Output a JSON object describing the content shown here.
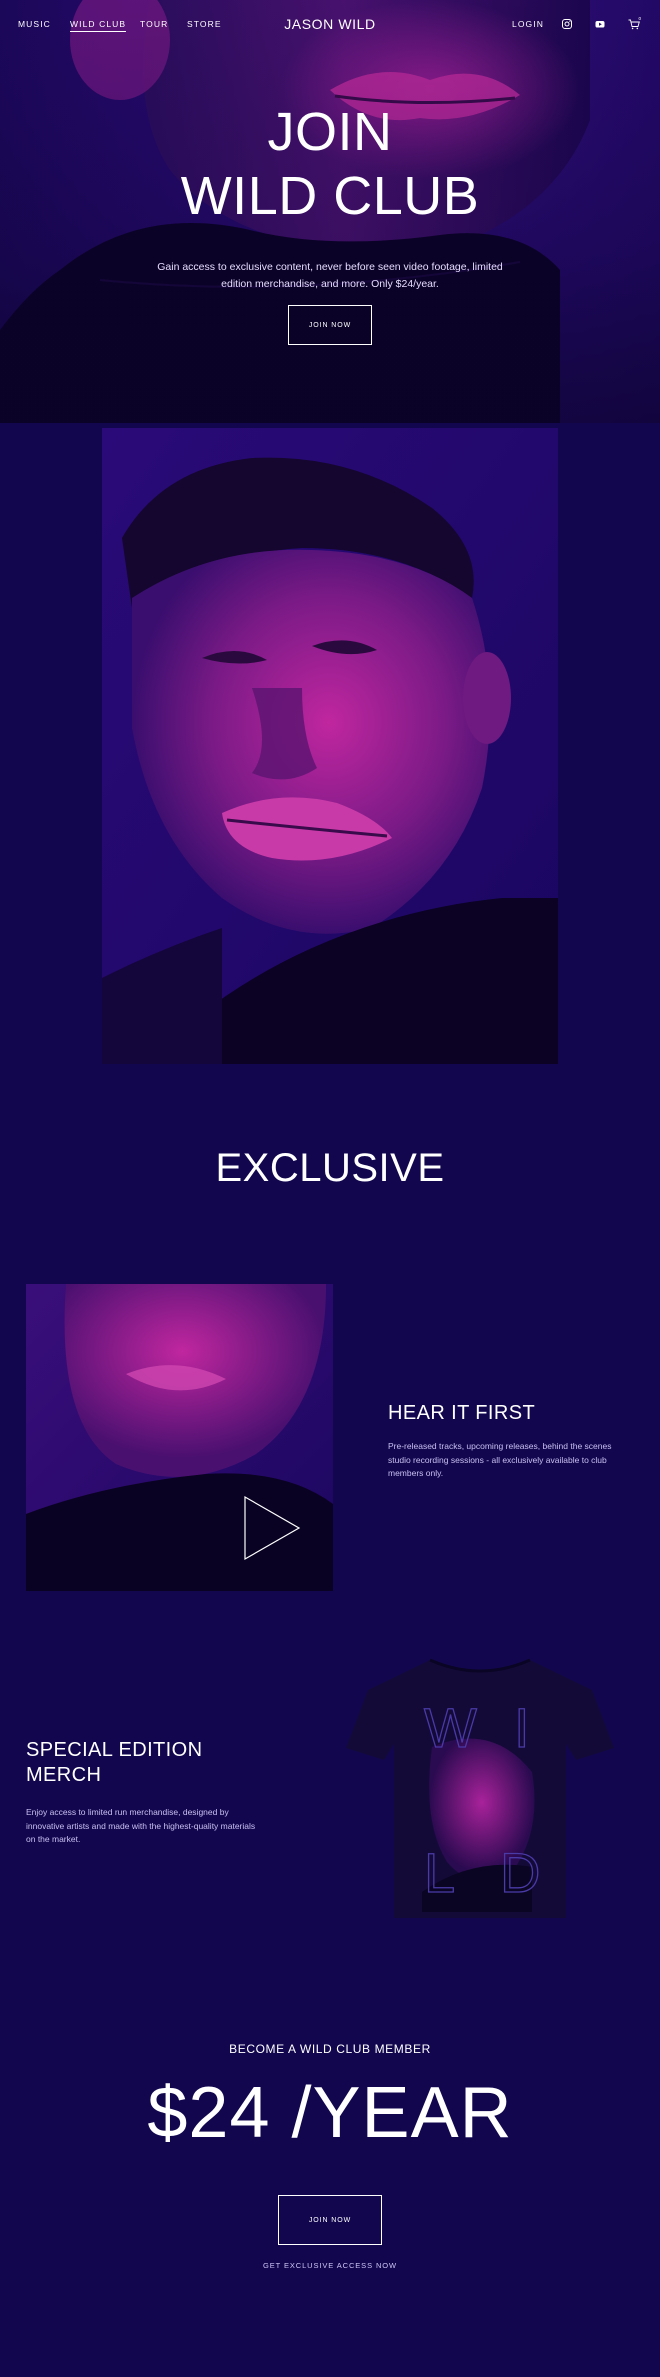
{
  "nav": {
    "links": [
      {
        "label": "MUSIC",
        "active": false
      },
      {
        "label": "WILD CLUB",
        "active": true
      },
      {
        "label": "TOUR",
        "active": false
      },
      {
        "label": "STORE",
        "active": false
      }
    ],
    "brand": "JASON WILD",
    "login": "LOGIN",
    "icons": [
      "instagram-icon",
      "youtube-icon",
      "cart-icon"
    ],
    "cart_count": "0"
  },
  "hero": {
    "title_line1": "JOIN",
    "title_line2": "WILD CLUB",
    "subtitle": "Gain access to exclusive content, never before seen video footage, limited edition merchandise, and more. Only $24/year.",
    "button": "JOIN NOW"
  },
  "exclusive": {
    "title": "EXCLUSIVE"
  },
  "hear_it_first": {
    "heading": "HEAR IT FIRST",
    "text": "Pre-released tracks, upcoming releases, behind the scenes studio recording sessions - all exclusively available to club members only."
  },
  "merch": {
    "heading_line1": "SPECIAL EDITION",
    "heading_line2": "MERCH",
    "text": "Enjoy access to limited run merchandise, designed by innovative artists and made with the highest-quality materials on the market.",
    "shirt_letters": [
      "W",
      "I",
      "L",
      "D"
    ]
  },
  "cta": {
    "eyebrow": "BECOME A WILD CLUB MEMBER",
    "price": "$24 /YEAR",
    "button": "JOIN NOW",
    "footnote": "GET EXCLUSIVE ACCESS NOW"
  },
  "colors": {
    "background": "#12074f",
    "accent_magenta": "#b0209f",
    "text": "#ffffff"
  }
}
